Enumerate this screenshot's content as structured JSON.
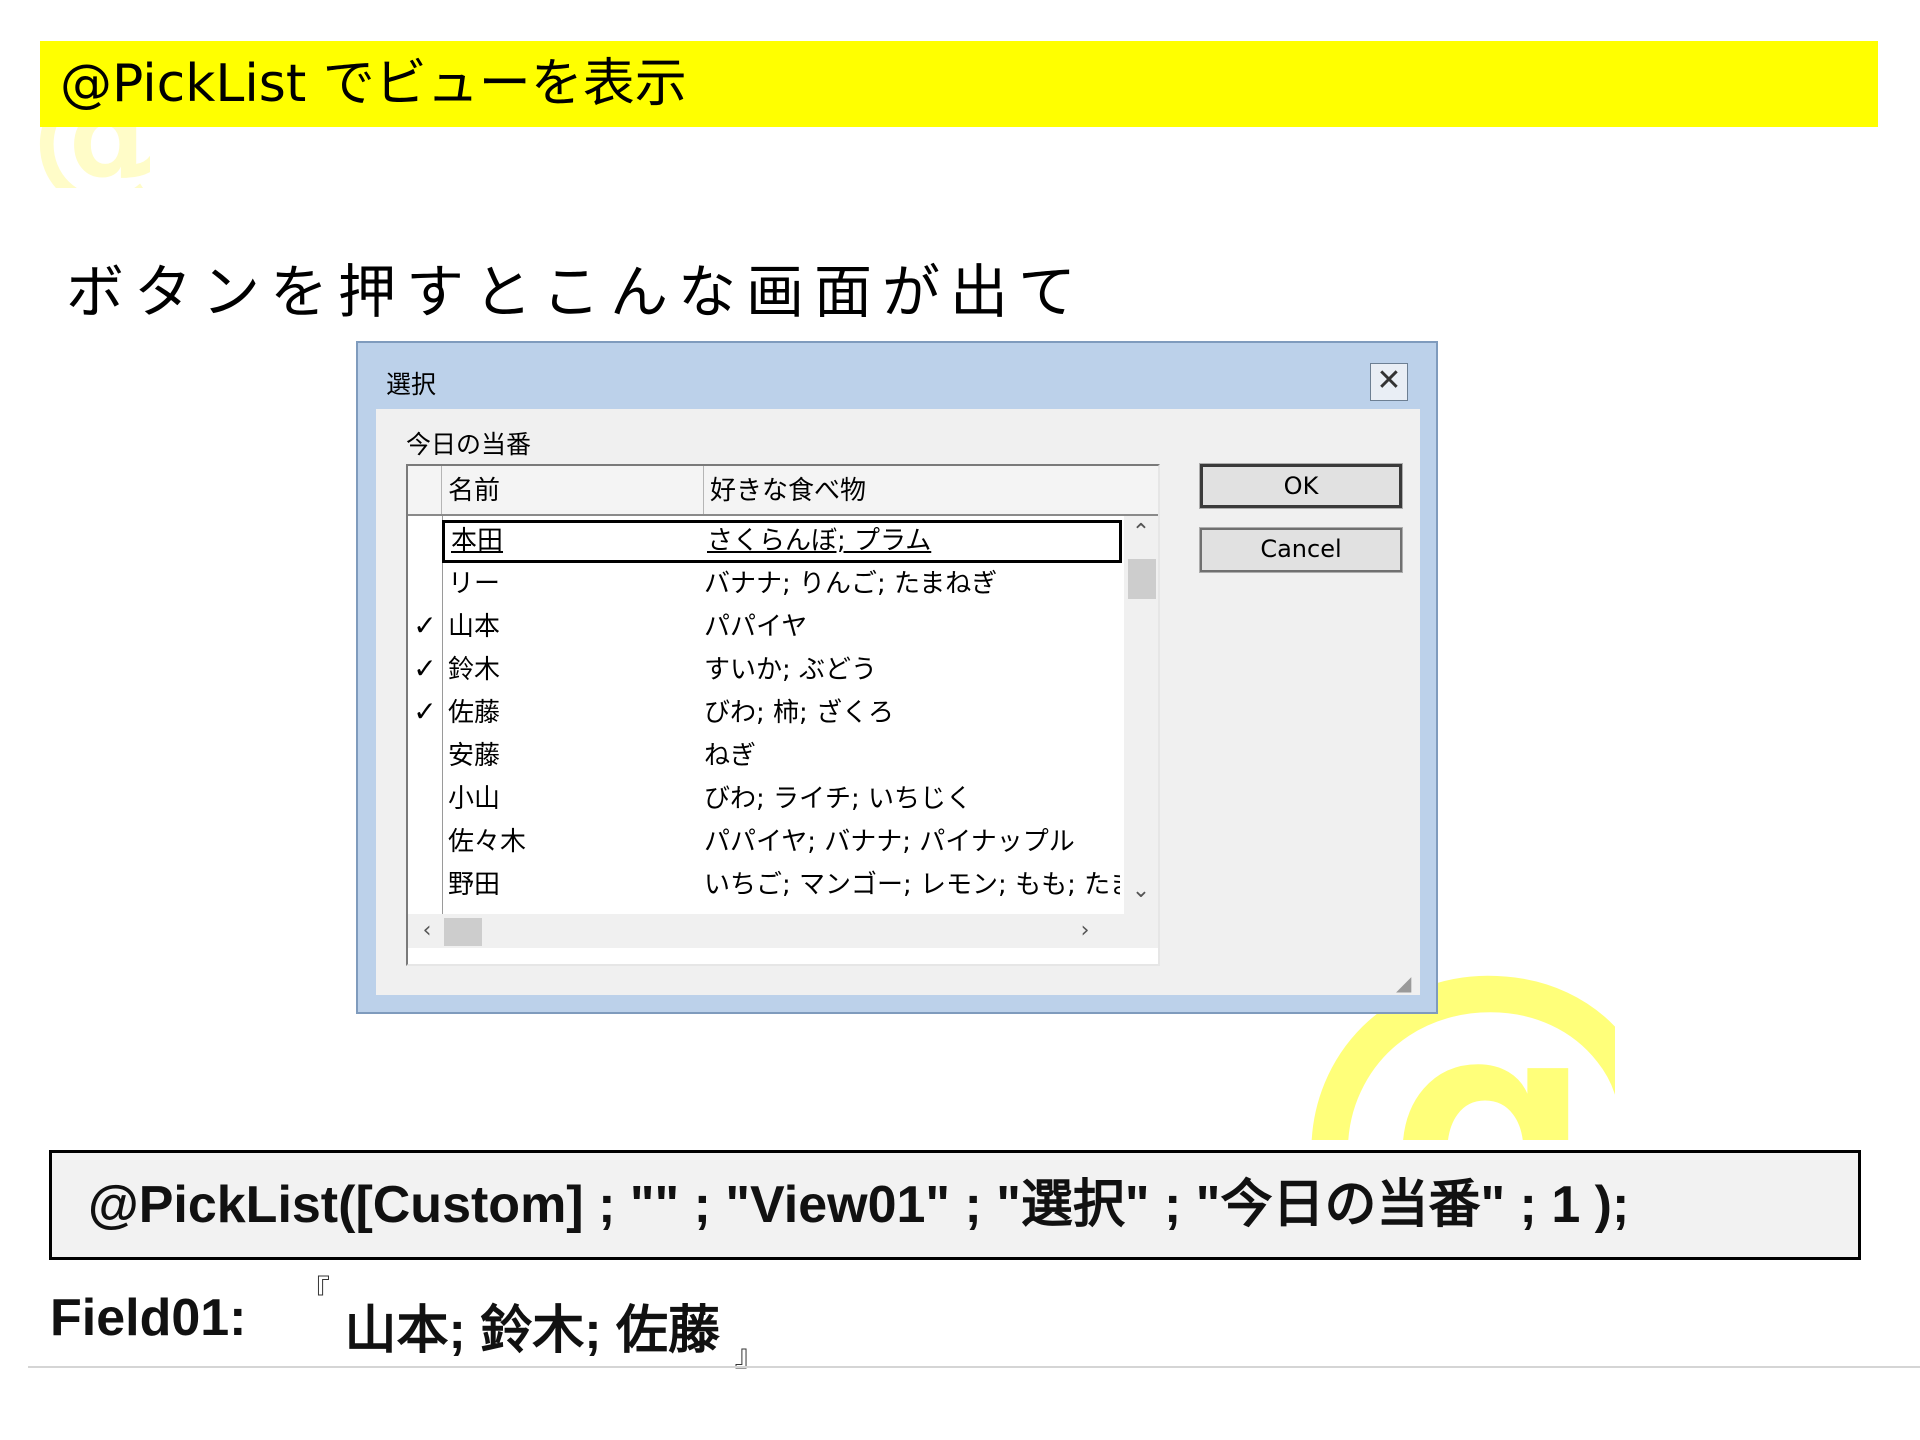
{
  "slide": {
    "title": "@PickList でビューを表示",
    "subtitle": "ボタンを押すとこんな画面が出て",
    "accent_color": "#ffff00"
  },
  "dialog": {
    "title": "選択",
    "close_icon": "close-icon",
    "group_label": "今日の当番",
    "ok_label": "OK",
    "cancel_label": "Cancel",
    "columns": [
      "名前",
      "好きな食べ物"
    ],
    "rows": [
      {
        "name": "本田",
        "food": "さくらんぼ; プラム",
        "checked": false,
        "selected": true
      },
      {
        "name": "リー",
        "food": "バナナ; りんご; たまねぎ",
        "checked": false,
        "selected": false
      },
      {
        "name": "山本",
        "food": "パパイヤ",
        "checked": true,
        "selected": false
      },
      {
        "name": "鈴木",
        "food": "すいか; ぶどう",
        "checked": true,
        "selected": false
      },
      {
        "name": "佐藤",
        "food": "びわ; 柿; ざくろ",
        "checked": true,
        "selected": false
      },
      {
        "name": "安藤",
        "food": "ねぎ",
        "checked": false,
        "selected": false
      },
      {
        "name": "小山",
        "food": "びわ; ライチ; いちじく",
        "checked": false,
        "selected": false
      },
      {
        "name": "佐々木",
        "food": "パパイヤ; バナナ; パイナップル",
        "checked": false,
        "selected": false
      },
      {
        "name": "野田",
        "food": "いちご; マンゴー; レモン; もも; たまねぎ",
        "checked": false,
        "selected": false
      }
    ]
  },
  "code": {
    "formula": "@PickList([Custom] ; \"\" ; \"View01\" ; \"選択\" ; \"今日の当番\" ; 1 );",
    "field_label": "Field01:",
    "open_bracket": "『",
    "field_value": "山本; 鈴木; 佐藤",
    "close_bracket": "』"
  }
}
